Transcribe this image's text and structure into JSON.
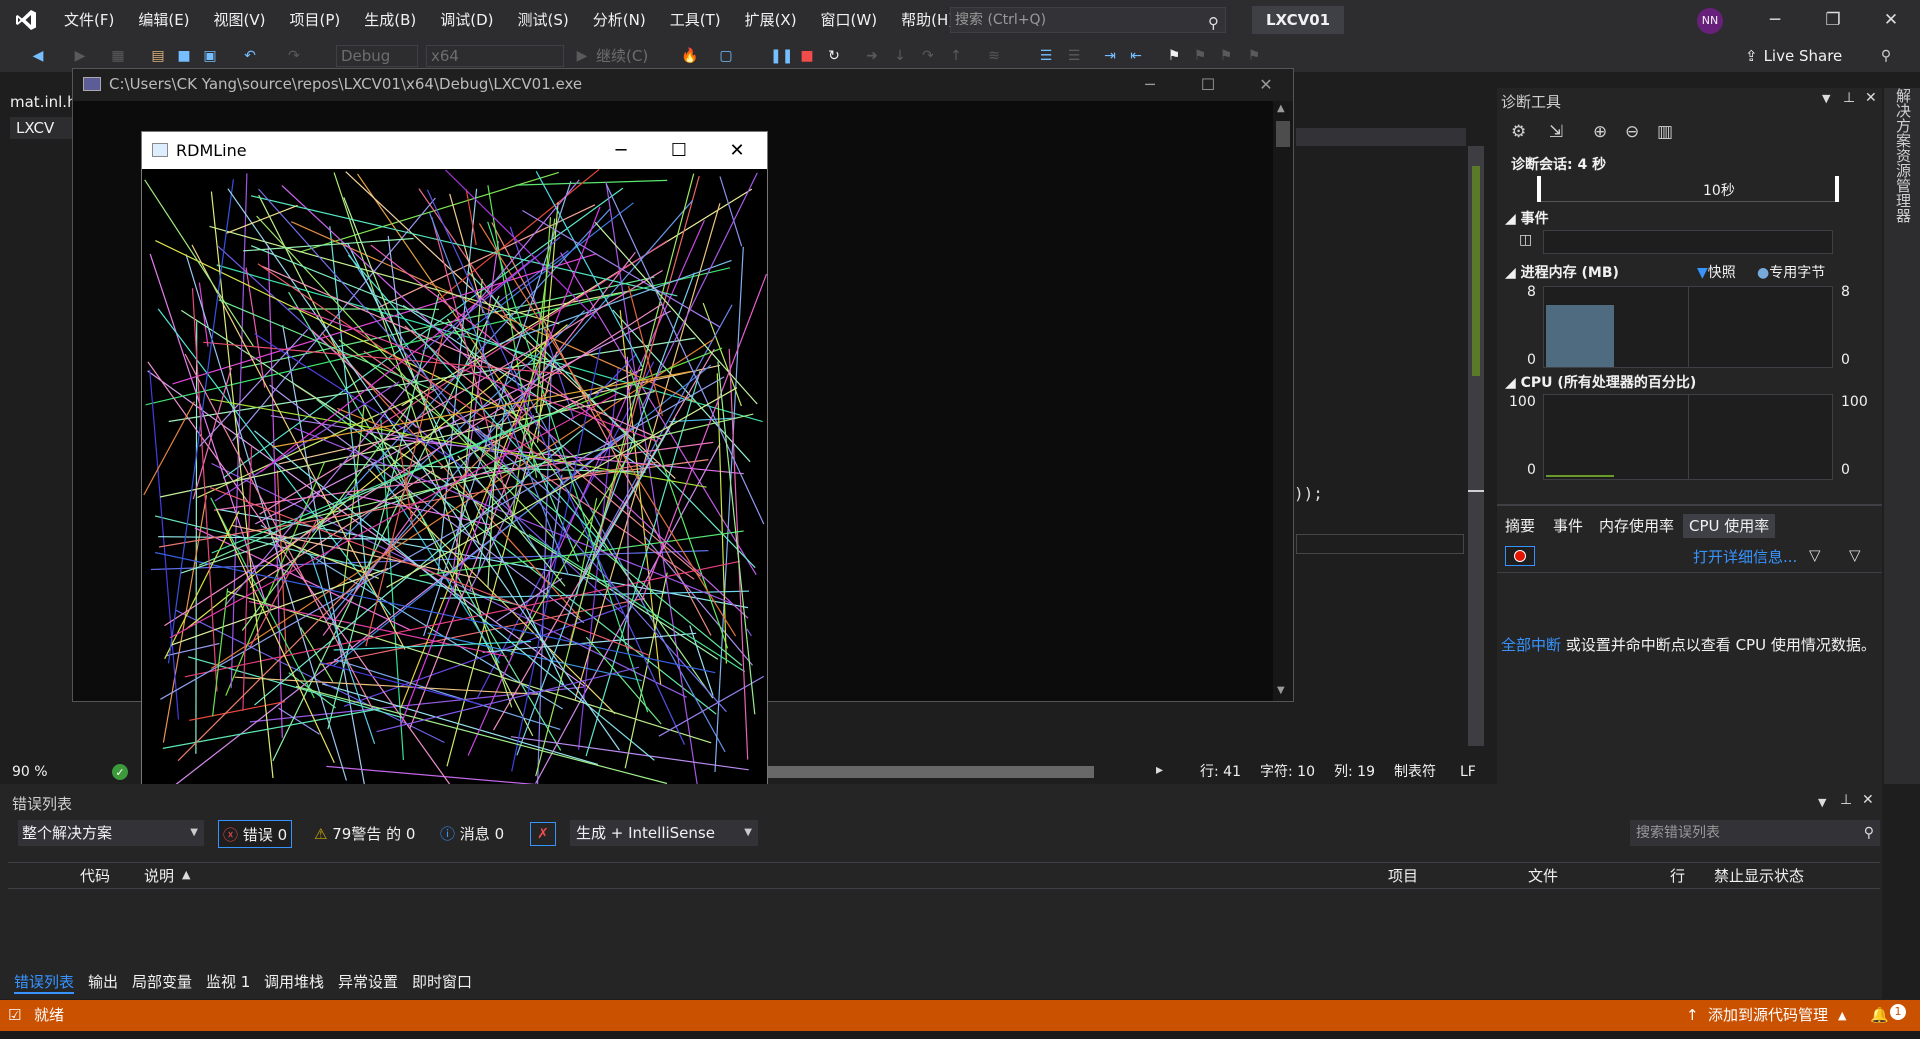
{
  "menu": {
    "items": [
      "文件(F)",
      "编辑(E)",
      "视图(V)",
      "项目(P)",
      "生成(B)",
      "调试(D)",
      "测试(S)",
      "分析(N)",
      "工具(T)",
      "扩展(X)",
      "窗口(W)",
      "帮助(H)"
    ],
    "search_placeholder": "搜索 (Ctrl+Q)",
    "solution_name": "LXCV01",
    "avatar_initials": "NN"
  },
  "toolbar": {
    "config": "Debug",
    "platform": "x64",
    "continue_label": "继续(C)",
    "live_share": "Live Share"
  },
  "editor": {
    "doc_tab": "mat.inl.h",
    "doc_tab2": "LXCV",
    "zoom": "90 %",
    "code_fragment": "));",
    "status": {
      "line": "行: 41",
      "char": "字符: 10",
      "col": "列: 19",
      "tabs": "制表符",
      "eol": "LF"
    }
  },
  "console": {
    "title": "C:\\Users\\CK Yang\\source\\repos\\LXCV01\\x64\\Debug\\LXCV01.exe"
  },
  "rdm_window": {
    "title": "RDMLine"
  },
  "diagnostics": {
    "title": "诊断工具",
    "session": "诊断会话: 4 秒",
    "timeline_label": "10秒",
    "events_label": "事件",
    "memory_label": "进程内存 (MB)",
    "snapshot_label": "快照",
    "private_bytes_label": "专用字节",
    "memory_max": "8",
    "memory_min": "0",
    "memory_fill_fraction": 0.78,
    "cpu_label": "CPU (所有处理器的百分比)",
    "cpu_max": "100",
    "cpu_min": "0",
    "tabs": [
      "摘要",
      "事件",
      "内存使用率",
      "CPU 使用率"
    ],
    "open_details": "打开详细信息...",
    "break_all": "全部中断",
    "cpu_message": "或设置并命中断点以查看 CPU 使用情况数据。"
  },
  "side_tab": "解决方案资源管理器",
  "error_list": {
    "title": "错误列表",
    "scope": "整个解决方案",
    "errors": "错误 0",
    "warnings": "79警告 的 0",
    "messages": "消息 0",
    "build_filter": "生成 + IntelliSense",
    "search_placeholder": "搜索错误列表",
    "columns": [
      "代码",
      "说明",
      "项目",
      "文件",
      "行",
      "禁止显示状态"
    ]
  },
  "bottom_tabs": [
    "错误列表",
    "输出",
    "局部变量",
    "监视 1",
    "调用堆栈",
    "异常设置",
    "即时窗口"
  ],
  "statusbar": {
    "ready": "就绪",
    "add_source_control": "添加到源代码管理",
    "notifications": "1"
  },
  "colors": {
    "accent": "#3794ff",
    "status_bar": "#ca5100",
    "chrome": "#2d2d30"
  }
}
